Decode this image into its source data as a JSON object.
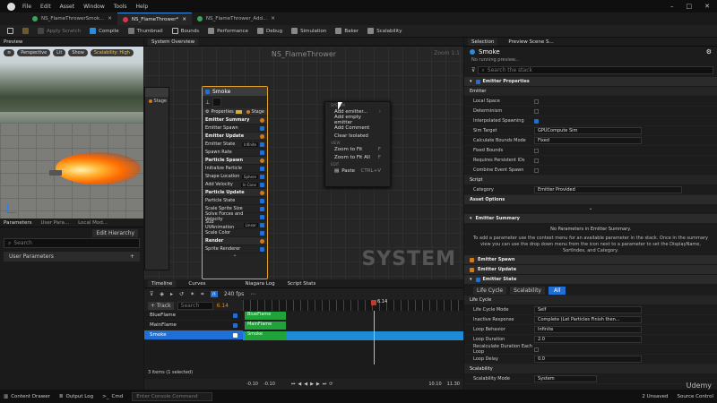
{
  "titlebar": {
    "menus": [
      "File",
      "Edit",
      "Asset",
      "Window",
      "Tools",
      "Help"
    ]
  },
  "tabs": [
    {
      "label": "NS_FlameThrowerSmok..."
    },
    {
      "label": "NS_FlameThrower*"
    },
    {
      "label": "NS_FlameThrower_Add..."
    }
  ],
  "toolbar": {
    "apply_scratch": "Apply Scratch",
    "compile": "Compile",
    "thumbnail": "Thumbnail",
    "bounds": "Bounds",
    "performance": "Performance",
    "debug": "Debug",
    "simulation": "Simulation",
    "baker": "Baker",
    "scalability": "Scalability"
  },
  "preview": {
    "title": "Preview",
    "perspective": "Perspective",
    "lit": "Lit",
    "show": "Show",
    "scalability": "Scalability: High"
  },
  "parameters": {
    "tabs": [
      "Parameters",
      "User Para...",
      "Local Mod..."
    ],
    "edit_hierarchy": "Edit Hierarchy",
    "search_placeholder": "Search",
    "user_parameters": "User Parameters"
  },
  "system_overview": {
    "tab": "System Overview",
    "graph_title": "NS_FlameThrower",
    "zoom": "Zoom 1:1",
    "watermark": "SYSTEM"
  },
  "left_node": {
    "stage": "Stage"
  },
  "node": {
    "title": "Smoke",
    "properties": "Properties",
    "stage": "Stage",
    "rows": [
      {
        "label": "Emitter Summary",
        "section": true
      },
      {
        "label": "Emitter Spawn",
        "section": false
      },
      {
        "label": "Emitter Update",
        "section": true
      },
      {
        "label": "Emitter State",
        "section": false,
        "value": "Infinite"
      },
      {
        "label": "Spawn Rate",
        "section": false
      },
      {
        "label": "Particle Spawn",
        "section": true
      },
      {
        "label": "Initialize Particle",
        "section": false
      },
      {
        "label": "Shape Location",
        "section": false,
        "value": "Sphere"
      },
      {
        "label": "Add Velocity",
        "section": false,
        "value": "In Cone"
      },
      {
        "label": "Particle Update",
        "section": true
      },
      {
        "label": "Particle State",
        "section": false
      },
      {
        "label": "Scale Sprite Size",
        "section": false
      },
      {
        "label": "Solve Forces and Velocity",
        "section": false
      },
      {
        "label": "Sub UVAnimation",
        "section": false,
        "value": "Linear"
      },
      {
        "label": "Scale Color",
        "section": false
      },
      {
        "label": "Render",
        "section": true
      },
      {
        "label": "Sprite Renderer",
        "section": false
      }
    ]
  },
  "context_menu": {
    "header": "SYSTEM",
    "items_a": [
      {
        "label": "Add emitter..."
      },
      {
        "label": "Add empty emitter"
      },
      {
        "label": "Add Comment"
      },
      {
        "label": "Clear Isolated"
      }
    ],
    "view_header": "VIEW",
    "items_b": [
      {
        "label": "Zoom to Fit",
        "shortcut": "F"
      },
      {
        "label": "Zoom to Fit All",
        "shortcut": "F"
      }
    ],
    "edit_header": "EDIT",
    "paste": "Paste",
    "paste_shortcut": "CTRL+V"
  },
  "timeline": {
    "tabs": [
      "Timeline",
      "Curves",
      "Niagara Log",
      "Script Stats"
    ],
    "fps": "240 fps",
    "add_track": "+ Track",
    "search": "Search",
    "time": "6.14",
    "playhead": "6.14",
    "tracks": [
      "BlueFlame",
      "MainFlame",
      "Smoke"
    ],
    "status": "3 items (1 selected)",
    "ruler": [
      "-0.10",
      "-0.10",
      "10.10",
      "11.30"
    ]
  },
  "selection": {
    "tab": "Selection",
    "tab2": "Preview Scene S...",
    "name": "Smoke",
    "running": "No running preview...",
    "search": "Search the stack",
    "emitter_props_title": "Emitter Properties",
    "emitter_label": "Emitter",
    "emitter_props": [
      {
        "k": "Local Space",
        "v": ""
      },
      {
        "k": "Determinism",
        "v": ""
      },
      {
        "k": "Interpolated Spawning",
        "v": "checked"
      },
      {
        "k": "Sim Target",
        "v": "GPUCompute Sim"
      },
      {
        "k": "Calculate Bounds Mode",
        "v": "Fixed"
      },
      {
        "k": "Fixed Bounds",
        "v": ""
      },
      {
        "k": "Requires Persistent IDs",
        "v": ""
      },
      {
        "k": "Combine Event Spawn",
        "v": ""
      }
    ],
    "script_label": "Script",
    "category_k": "Category",
    "category_v": "Emitter Provided",
    "asset_options": "Asset Options",
    "summary_title": "Emitter Summary",
    "summary_none": "No Parameters in Emitter Summary.",
    "summary_help": "To add a parameter use the context menu for an available parameter in the stack. Once in the summary view you can use the drop down menu from the icon next to a parameter to set the DisplayName, SortIndex, and Category.",
    "emitter_spawn": "Emitter Spawn",
    "emitter_update": "Emitter Update",
    "emitter_state": "Emitter State",
    "state_tabs": [
      "Life Cycle",
      "Scalability",
      "All"
    ],
    "lifecycle_label": "Life Cycle",
    "lifecycle": [
      {
        "k": "Life Cycle Mode",
        "v": "Self"
      },
      {
        "k": "Inactive Response",
        "v": "Complete (Let Particles Finish then..."
      },
      {
        "k": "Loop Behavior",
        "v": "Infinite"
      },
      {
        "k": "Loop Duration",
        "v": "2.0"
      },
      {
        "k": "Recalculate Duration Each Loop",
        "v": ""
      },
      {
        "k": "Loop Delay",
        "v": "0.0"
      }
    ],
    "scalability_label": "Scalability",
    "scal_mode_k": "Scalability Mode",
    "scal_mode_v": "System"
  },
  "statusbar": {
    "content_drawer": "Content Drawer",
    "output_log": "Output Log",
    "cmd": "Cmd",
    "console_placeholder": "Enter Console Command",
    "unsaved": "2 Unsaved",
    "source_control": "Source Control",
    "udemy": "Udemy"
  }
}
